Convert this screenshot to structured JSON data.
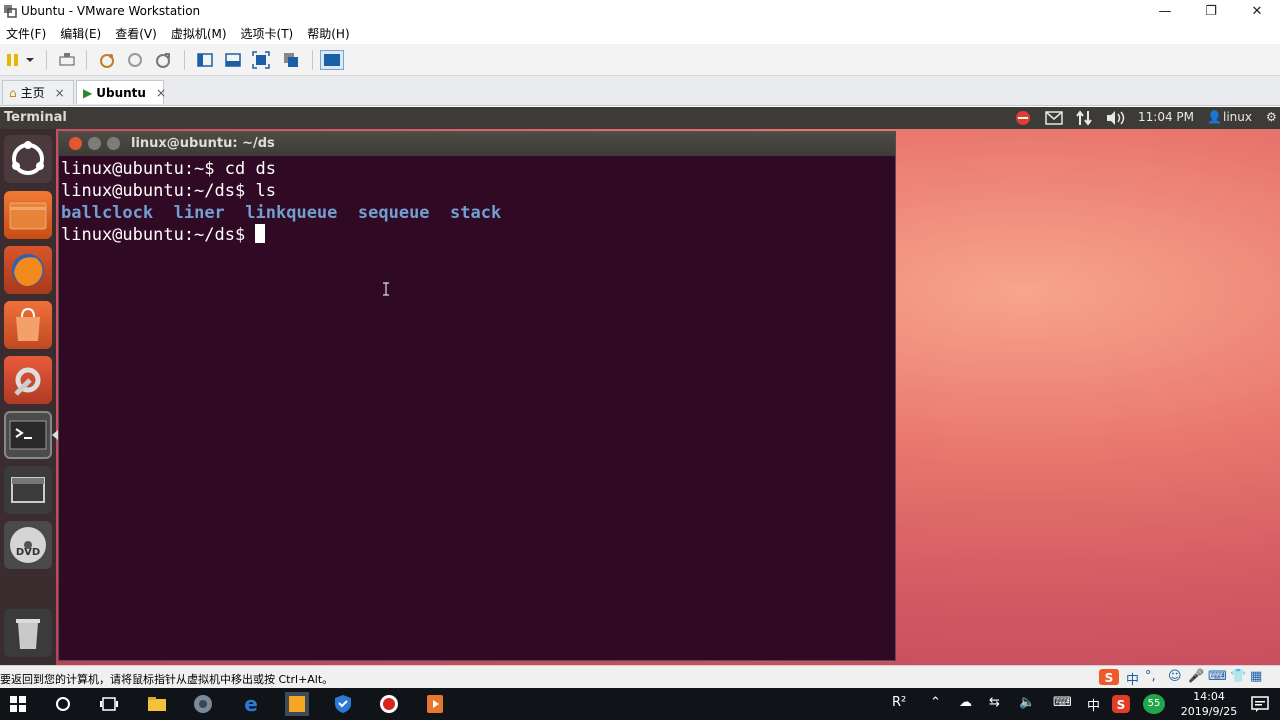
{
  "window": {
    "title": "Ubuntu - VMware Workstation"
  },
  "menu": [
    "文件(F)",
    "编辑(E)",
    "查看(V)",
    "虚拟机(M)",
    "选项卡(T)",
    "帮助(H)"
  ],
  "tabs": [
    {
      "label": "主页",
      "close": "×"
    },
    {
      "label": "Ubuntu",
      "close": "×"
    }
  ],
  "panel": {
    "title": "Terminal",
    "time": "11:04 PM",
    "user": "linux"
  },
  "terminal": {
    "title": "linux@ubuntu: ~/ds",
    "lines": [
      "linux@ubuntu:~$ cd ds",
      "linux@ubuntu:~/ds$ ls"
    ],
    "ls_output": [
      "ballclock",
      "liner",
      "linkqueue",
      "sequeue",
      "stack"
    ],
    "prompt": "linux@ubuntu:~/ds$ "
  },
  "launcher": [
    "ubuntu-dash",
    "files",
    "firefox",
    "software-center",
    "system-settings",
    "terminal",
    "workspace-switcher",
    "dvd",
    "trash"
  ],
  "vm_status": {
    "message": "要返回到您的计算机，请将鼠标指针从虚拟机中移出或按 Ctrl+Alt。"
  },
  "taskbar": {
    "ime": "中",
    "time": "14:04",
    "date": "2019/9/25",
    "badge": "55"
  },
  "colors": {
    "terminal_bg": "#300a24",
    "dir_color": "#729fcf",
    "panel_bg": "#3c3b37"
  }
}
